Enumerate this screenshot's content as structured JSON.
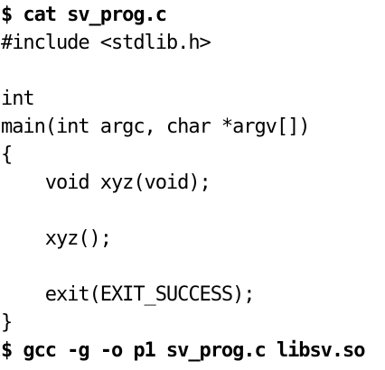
{
  "listing": {
    "lines": [
      {
        "text": "$ cat sv_prog.c",
        "bold": true
      },
      {
        "text": "#include <stdlib.h>",
        "bold": false
      },
      {
        "text": "",
        "bold": false
      },
      {
        "text": "int",
        "bold": false
      },
      {
        "text": "main(int argc, char *argv[])",
        "bold": false
      },
      {
        "text": "{",
        "bold": false
      },
      {
        "text": "    void xyz(void);",
        "bold": false
      },
      {
        "text": "",
        "bold": false
      },
      {
        "text": "    xyz();",
        "bold": false
      },
      {
        "text": "",
        "bold": false
      },
      {
        "text": "    exit(EXIT_SUCCESS);",
        "bold": false
      },
      {
        "text": "}",
        "bold": false
      },
      {
        "text": "$ gcc -g -o p1 sv_prog.c libsv.so",
        "bold": true
      }
    ]
  }
}
